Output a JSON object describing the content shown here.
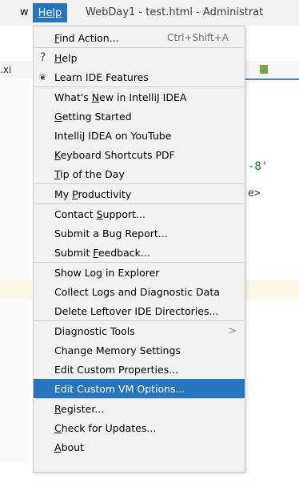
{
  "menubar": {
    "prev_menu_fragment": "w",
    "help_label": "Help",
    "window_title": "WebDay1 - test.html - Administrat"
  },
  "background": {
    "file_tab_fragment": ".xi",
    "code_fragment_1": "-8'",
    "code_fragment_2": "e>"
  },
  "help_menu": {
    "items": [
      {
        "label": "Find Action...",
        "mnemonic": "F",
        "shortcut": "Ctrl+Shift+A"
      },
      {
        "label": "Help",
        "mnemonic": "H",
        "icon": "question-icon"
      },
      {
        "label": "Learn IDE Features",
        "icon": "graduation-cap-icon"
      },
      {
        "label": "What's New in IntelliJ IDEA",
        "mnemonic": "N"
      },
      {
        "label": "Getting Started",
        "mnemonic": "G"
      },
      {
        "label": "IntelliJ IDEA on YouTube"
      },
      {
        "label": "Keyboard Shortcuts PDF",
        "mnemonic": "K"
      },
      {
        "label": "Tip of the Day",
        "mnemonic": "T"
      },
      {
        "label": "My Productivity",
        "mnemonic": "P"
      },
      {
        "label": "Contact Support...",
        "mnemonic": "S"
      },
      {
        "label": "Submit a Bug Report..."
      },
      {
        "label": "Submit Feedback...",
        "mnemonic": "F"
      },
      {
        "label": "Show Log in Explorer"
      },
      {
        "label": "Collect Logs and Diagnostic Data"
      },
      {
        "label": "Delete Leftover IDE Directories..."
      },
      {
        "label": "Diagnostic Tools",
        "submenu_arrow": ">"
      },
      {
        "label": "Change Memory Settings"
      },
      {
        "label": "Edit Custom Properties..."
      },
      {
        "label": "Edit Custom VM Options...",
        "selected": true
      },
      {
        "label": "Register...",
        "mnemonic": "R"
      },
      {
        "label": "Check for Updates...",
        "mnemonic": "C"
      },
      {
        "label": "About",
        "mnemonic": "A"
      }
    ]
  }
}
